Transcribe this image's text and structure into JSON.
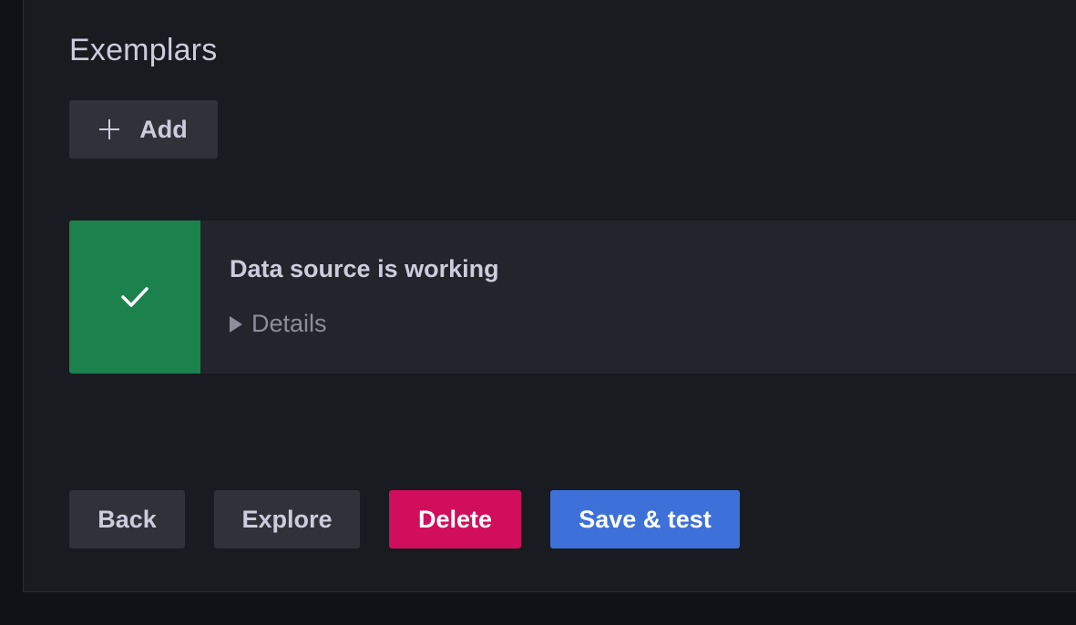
{
  "exemplars": {
    "title": "Exemplars",
    "add_label": "Add"
  },
  "alert": {
    "status": "success",
    "color": "#1b814d",
    "title": "Data source is working",
    "details_label": "Details"
  },
  "actions": {
    "back_label": "Back",
    "explore_label": "Explore",
    "delete_label": "Delete",
    "save_test_label": "Save & test"
  },
  "colors": {
    "background": "#181b1f",
    "secondary_button": "#2f3238",
    "delete_button": "#d10e5c",
    "primary_button": "#3d71d9",
    "success": "#1b814d"
  }
}
